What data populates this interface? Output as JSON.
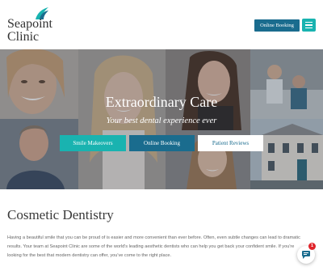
{
  "header": {
    "logo_line1": "Seapoint",
    "logo_line2": "Clinic",
    "booking_label": "Online Booking",
    "menu_icon": "hamburger-icon"
  },
  "hero": {
    "title": "Extraordinary Care",
    "subtitle": "Your best dental experience ever",
    "buttons": [
      {
        "label": "Smile Makeovers"
      },
      {
        "label": "Online Booking"
      },
      {
        "label": "Patient Reviews"
      }
    ]
  },
  "content": {
    "title": "Cosmetic Dentistry",
    "paragraph_lines": [
      "Having a beautiful smile that you can be proud of is easier and more convenient than ever before. Often, even subtle changes can lead to dramatic",
      "results. Your team at Seapoint Clinic are some of the world's leading aesthetic dentists who can help you get back your confident smile. If you're",
      "looking for the best that modern dentistry can offer, you've come to the right place."
    ]
  },
  "chat": {
    "badge": "1",
    "icon": "chat-icon"
  },
  "colors": {
    "teal": "#19b3b0",
    "blue": "#1a6c8e",
    "badge_red": "#e0242b"
  }
}
